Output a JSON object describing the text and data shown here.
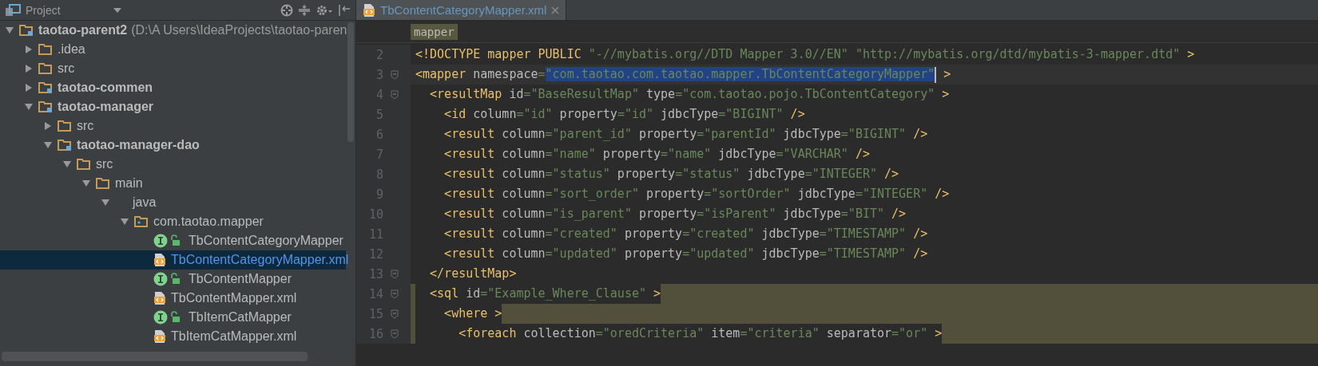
{
  "project_panel": {
    "title": "Project",
    "tree": [
      {
        "kind": "module",
        "label": "taotao-parent2",
        "path": "(D:\\A Users\\IdeaProjects\\taotao-paren",
        "expanded": true,
        "selected": false,
        "children": [
          {
            "kind": "folder",
            "label": ".idea",
            "expanded": false,
            "selected": false
          },
          {
            "kind": "folder",
            "label": "src",
            "expanded": false,
            "selected": false
          },
          {
            "kind": "module",
            "label": "taotao-commen",
            "expanded": false,
            "selected": false
          },
          {
            "kind": "module",
            "label": "taotao-manager",
            "expanded": true,
            "selected": false,
            "children": [
              {
                "kind": "folder",
                "label": "src",
                "expanded": false,
                "selected": false
              },
              {
                "kind": "module",
                "label": "taotao-manager-dao",
                "expanded": true,
                "selected": false,
                "children": [
                  {
                    "kind": "folder",
                    "label": "src",
                    "expanded": true,
                    "selected": false,
                    "children": [
                      {
                        "kind": "folder",
                        "label": "main",
                        "expanded": true,
                        "selected": false,
                        "children": [
                          {
                            "kind": "source",
                            "label": "java",
                            "expanded": true,
                            "selected": false,
                            "children": [
                              {
                                "kind": "package",
                                "label": "com.taotao.mapper",
                                "expanded": true,
                                "selected": false,
                                "children": [
                                  {
                                    "kind": "interface",
                                    "label": "TbContentCategoryMapper",
                                    "selected": false
                                  },
                                  {
                                    "kind": "xml",
                                    "label": "TbContentCategoryMapper.xml",
                                    "selected": true
                                  },
                                  {
                                    "kind": "interface",
                                    "label": "TbContentMapper",
                                    "selected": false
                                  },
                                  {
                                    "kind": "xml",
                                    "label": "TbContentMapper.xml",
                                    "selected": false
                                  },
                                  {
                                    "kind": "interface",
                                    "label": "TbItemCatMapper",
                                    "selected": false
                                  },
                                  {
                                    "kind": "xml",
                                    "label": "TbItemCatMapper.xml",
                                    "selected": false
                                  }
                                ]
                              }
                            ]
                          }
                        ]
                      }
                    ]
                  }
                ]
              }
            ]
          }
        ]
      }
    ]
  },
  "editor": {
    "tabs": [
      {
        "label": "TbContentCategoryMapper.xml",
        "selected": true
      }
    ],
    "breadcrumb": "mapper",
    "lines": [
      {
        "number": "2",
        "fold": false,
        "current": false,
        "matched": false,
        "tokens": [
          {
            "kind": "tag",
            "text": "<!DOCTYPE mapper PUBLIC "
          },
          {
            "kind": "value",
            "text": "\"-//mybatis.org//DTD Mapper 3.0//EN\" \"http://mybatis.org/dtd/mybatis-3-mapper.dtd\""
          },
          {
            "kind": "tag",
            "text": " >"
          }
        ]
      },
      {
        "number": "3",
        "fold": true,
        "current": true,
        "matched": false,
        "tokens": [
          {
            "kind": "tag",
            "text": "<mapper"
          },
          {
            "kind": "attr",
            "text": " namespace"
          },
          {
            "kind": "value",
            "text": "="
          },
          {
            "kind": "selection",
            "text": "\"com.taotao.com.taotao.mapper.TbContentCategoryMapper\""
          },
          {
            "kind": "tag",
            "text": " >"
          }
        ]
      },
      {
        "number": "4",
        "fold": true,
        "current": false,
        "matched": false,
        "tokens": [
          {
            "kind": "tag",
            "text": "  <resultMap"
          },
          {
            "kind": "attr",
            "text": " id"
          },
          {
            "kind": "value",
            "text": "=\"BaseResultMap\""
          },
          {
            "kind": "attr",
            "text": " type"
          },
          {
            "kind": "value",
            "text": "=\"com.taotao.pojo.TbContentCategory\""
          },
          {
            "kind": "tag",
            "text": " >"
          }
        ]
      },
      {
        "number": "5",
        "fold": false,
        "current": false,
        "matched": false,
        "tokens": [
          {
            "kind": "tag",
            "text": "    <id"
          },
          {
            "kind": "attr",
            "text": " column"
          },
          {
            "kind": "value",
            "text": "=\"id\""
          },
          {
            "kind": "attr",
            "text": " property"
          },
          {
            "kind": "value",
            "text": "=\"id\""
          },
          {
            "kind": "attr",
            "text": " jdbcType"
          },
          {
            "kind": "value",
            "text": "=\"BIGINT\""
          },
          {
            "kind": "tag",
            "text": " />"
          }
        ]
      },
      {
        "number": "6",
        "fold": false,
        "current": false,
        "matched": false,
        "tokens": [
          {
            "kind": "tag",
            "text": "    <result"
          },
          {
            "kind": "attr",
            "text": " column"
          },
          {
            "kind": "value",
            "text": "=\"parent_id\""
          },
          {
            "kind": "attr",
            "text": " property"
          },
          {
            "kind": "value",
            "text": "=\"parentId\""
          },
          {
            "kind": "attr",
            "text": " jdbcType"
          },
          {
            "kind": "value",
            "text": "=\"BIGINT\""
          },
          {
            "kind": "tag",
            "text": " />"
          }
        ]
      },
      {
        "number": "7",
        "fold": false,
        "current": false,
        "matched": false,
        "tokens": [
          {
            "kind": "tag",
            "text": "    <result"
          },
          {
            "kind": "attr",
            "text": " column"
          },
          {
            "kind": "value",
            "text": "=\"name\""
          },
          {
            "kind": "attr",
            "text": " property"
          },
          {
            "kind": "value",
            "text": "=\"name\""
          },
          {
            "kind": "attr",
            "text": " jdbcType"
          },
          {
            "kind": "value",
            "text": "=\"VARCHAR\""
          },
          {
            "kind": "tag",
            "text": " />"
          }
        ]
      },
      {
        "number": "8",
        "fold": false,
        "current": false,
        "matched": false,
        "tokens": [
          {
            "kind": "tag",
            "text": "    <result"
          },
          {
            "kind": "attr",
            "text": " column"
          },
          {
            "kind": "value",
            "text": "=\"status\""
          },
          {
            "kind": "attr",
            "text": " property"
          },
          {
            "kind": "value",
            "text": "=\"status\""
          },
          {
            "kind": "attr",
            "text": " jdbcType"
          },
          {
            "kind": "value",
            "text": "=\"INTEGER\""
          },
          {
            "kind": "tag",
            "text": " />"
          }
        ]
      },
      {
        "number": "9",
        "fold": false,
        "current": false,
        "matched": false,
        "tokens": [
          {
            "kind": "tag",
            "text": "    <result"
          },
          {
            "kind": "attr",
            "text": " column"
          },
          {
            "kind": "value",
            "text": "=\"sort_order\""
          },
          {
            "kind": "attr",
            "text": " property"
          },
          {
            "kind": "value",
            "text": "=\"sortOrder\""
          },
          {
            "kind": "attr",
            "text": " jdbcType"
          },
          {
            "kind": "value",
            "text": "=\"INTEGER\""
          },
          {
            "kind": "tag",
            "text": " />"
          }
        ]
      },
      {
        "number": "10",
        "fold": false,
        "current": false,
        "matched": false,
        "tokens": [
          {
            "kind": "tag",
            "text": "    <result"
          },
          {
            "kind": "attr",
            "text": " column"
          },
          {
            "kind": "value",
            "text": "=\"is_parent\""
          },
          {
            "kind": "attr",
            "text": " property"
          },
          {
            "kind": "value",
            "text": "=\"isParent\""
          },
          {
            "kind": "attr",
            "text": " jdbcType"
          },
          {
            "kind": "value",
            "text": "=\"BIT\""
          },
          {
            "kind": "tag",
            "text": " />"
          }
        ]
      },
      {
        "number": "11",
        "fold": false,
        "current": false,
        "matched": false,
        "tokens": [
          {
            "kind": "tag",
            "text": "    <result"
          },
          {
            "kind": "attr",
            "text": " column"
          },
          {
            "kind": "value",
            "text": "=\"created\""
          },
          {
            "kind": "attr",
            "text": " property"
          },
          {
            "kind": "value",
            "text": "=\"created\""
          },
          {
            "kind": "attr",
            "text": " jdbcType"
          },
          {
            "kind": "value",
            "text": "=\"TIMESTAMP\""
          },
          {
            "kind": "tag",
            "text": " />"
          }
        ]
      },
      {
        "number": "12",
        "fold": false,
        "current": false,
        "matched": false,
        "tokens": [
          {
            "kind": "tag",
            "text": "    <result"
          },
          {
            "kind": "attr",
            "text": " column"
          },
          {
            "kind": "value",
            "text": "=\"updated\""
          },
          {
            "kind": "attr",
            "text": " property"
          },
          {
            "kind": "value",
            "text": "=\"updated\""
          },
          {
            "kind": "attr",
            "text": " jdbcType"
          },
          {
            "kind": "value",
            "text": "=\"TIMESTAMP\""
          },
          {
            "kind": "tag",
            "text": " />"
          }
        ]
      },
      {
        "number": "13",
        "fold": true,
        "current": false,
        "matched": false,
        "tokens": [
          {
            "kind": "tag",
            "text": "  </resultMap>"
          }
        ]
      },
      {
        "number": "14",
        "fold": true,
        "current": false,
        "matched": true,
        "tokens": [
          {
            "kind": "tag",
            "text": "  <sql"
          },
          {
            "kind": "attr",
            "text": " id"
          },
          {
            "kind": "value",
            "text": "=\"Example_Where_Clause\""
          },
          {
            "kind": "tag",
            "text": " >"
          }
        ]
      },
      {
        "number": "15",
        "fold": true,
        "current": false,
        "matched": true,
        "tokens": [
          {
            "kind": "tag",
            "text": "    <where >"
          }
        ]
      },
      {
        "number": "16",
        "fold": true,
        "current": false,
        "matched": true,
        "tokens": [
          {
            "kind": "tag",
            "text": "      <foreach"
          },
          {
            "kind": "attr",
            "text": " collection"
          },
          {
            "kind": "value",
            "text": "=\"oredCriteria\""
          },
          {
            "kind": "attr",
            "text": " item"
          },
          {
            "kind": "value",
            "text": "=\"criteria\""
          },
          {
            "kind": "attr",
            "text": " separator"
          },
          {
            "kind": "value",
            "text": "=\"or\""
          },
          {
            "kind": "tag",
            "text": " >"
          }
        ]
      }
    ]
  }
}
